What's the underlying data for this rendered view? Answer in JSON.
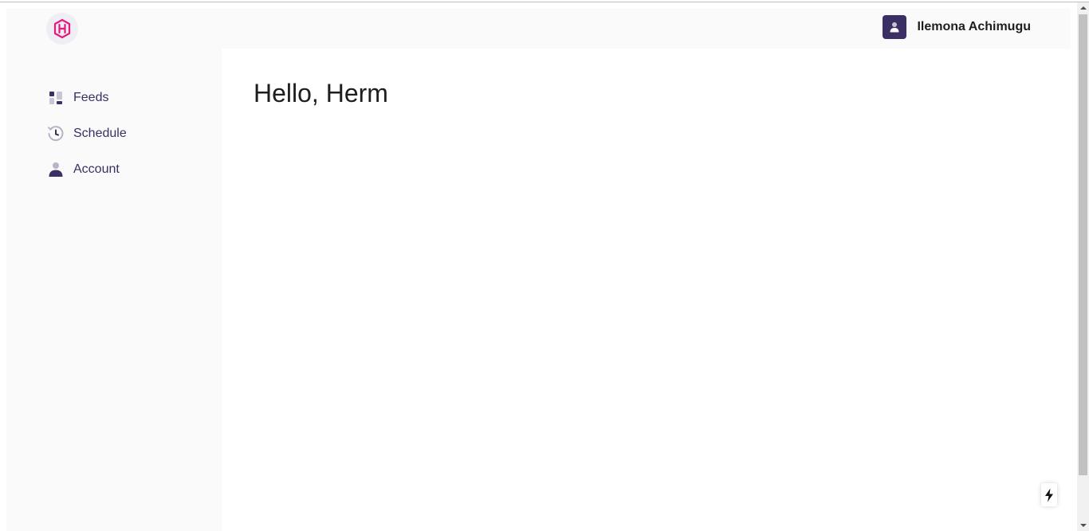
{
  "header": {
    "logo_icon": "hexagon-h-logo",
    "user": {
      "name": "Ilemona Achimugu",
      "avatar_icon": "user-icon"
    }
  },
  "sidebar": {
    "items": [
      {
        "label": "Feeds",
        "icon": "feeds-icon"
      },
      {
        "label": "Schedule",
        "icon": "history-clock-icon"
      },
      {
        "label": "Account",
        "icon": "person-icon"
      }
    ]
  },
  "main": {
    "greeting": "Hello, Herm"
  },
  "colors": {
    "brand_pink": "#e6197d",
    "brand_purple": "#3b2f63",
    "sidebar_bg": "#fafafa",
    "main_bg": "#ffffff"
  }
}
